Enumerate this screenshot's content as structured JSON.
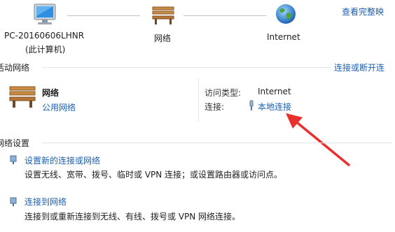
{
  "map": {
    "computer_name": "PC-20160606LHNR",
    "computer_sub": "(此计算机)",
    "network_label": "网络",
    "internet_label": "Internet",
    "view_full_map": "查看完整映"
  },
  "active": {
    "header": "活动网络",
    "connect_link": "连接或断开连",
    "network_name": "网络",
    "network_type": "公用网络",
    "access_type_label": "访问类型:",
    "access_type_value": "Internet",
    "connection_label": "连接:",
    "connection_value": "本地连接"
  },
  "settings": {
    "header": "网络设置",
    "tasks": [
      {
        "title": "设置新的连接或网络",
        "desc": "设置无线、宽带、拨号、临时或 VPN 连接；或设置路由器或访问点。"
      },
      {
        "title": "连接到网络",
        "desc": "连接到或重新连接到无线、有线、拨号或 VPN 网络连接。"
      }
    ]
  },
  "colors": {
    "link": "#1a5fb4",
    "annotation_arrow": "#e8312c"
  }
}
